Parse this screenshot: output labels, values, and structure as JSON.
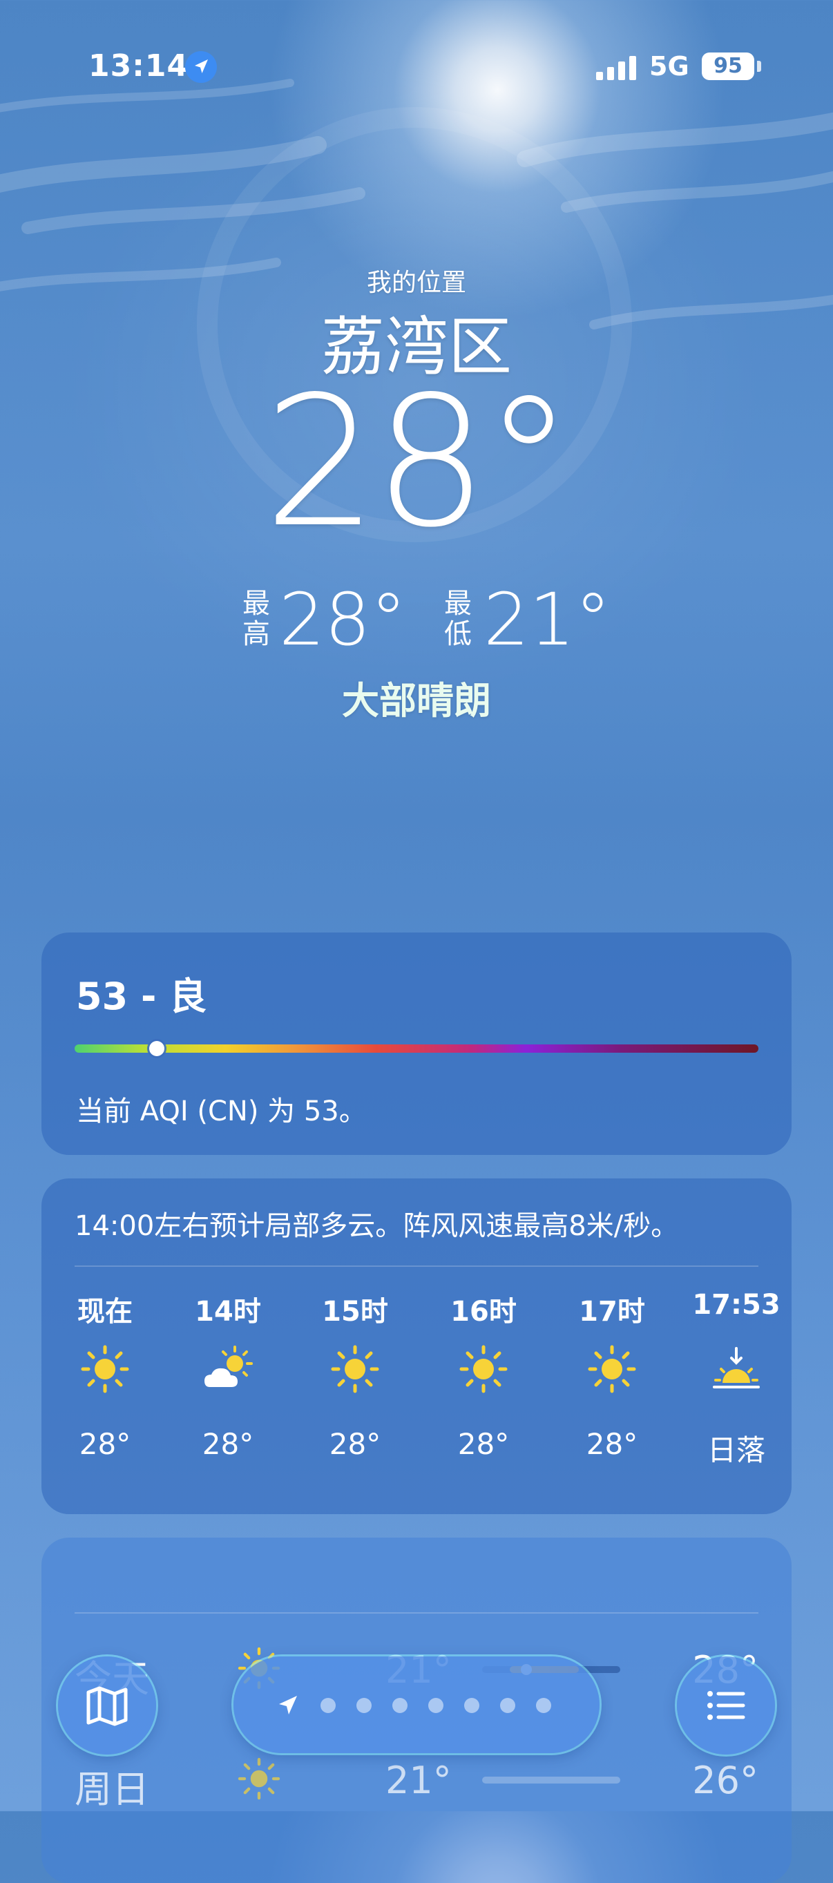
{
  "status_bar": {
    "time": "13:14",
    "network": "5G",
    "battery": "95"
  },
  "header": {
    "location_label": "我的位置",
    "city": "荔湾区",
    "current_temp": "28°",
    "high_label": "最高",
    "high_value": "28°",
    "low_label": "最低",
    "low_value": "21°",
    "condition": "大部晴朗"
  },
  "aqi": {
    "title": "53 - 良",
    "description": "当前 AQI (CN) 为 53。",
    "level_fraction": 0.12
  },
  "hourly": {
    "summary": "14:00左右预计局部多云。阵风风速最高8米/秒。",
    "items": [
      {
        "label": "现在",
        "icon": "sun-icon",
        "temp": "28°"
      },
      {
        "label": "14时",
        "icon": "partly-cloudy-icon",
        "temp": "28°"
      },
      {
        "label": "15时",
        "icon": "sun-icon",
        "temp": "28°"
      },
      {
        "label": "16时",
        "icon": "sun-icon",
        "temp": "28°"
      },
      {
        "label": "17时",
        "icon": "sun-icon",
        "temp": "28°"
      },
      {
        "label": "17:53",
        "icon": "sunset-icon",
        "temp": "日落"
      }
    ]
  },
  "daily": {
    "rows": [
      {
        "day": "今天",
        "icon": "sun-icon",
        "low": "21°",
        "high": "28°"
      },
      {
        "day": "周日",
        "icon": "sun-icon",
        "low": "21°",
        "high": "26°"
      }
    ]
  },
  "toolbar": {
    "map_icon": "map-icon",
    "location_icon": "location-arrow-icon",
    "page_count": 7,
    "list_icon": "list-icon"
  },
  "colors": {
    "sun": "#f7d338",
    "location_badge": "#3d8cf2",
    "condition_text": "#e9fbef"
  }
}
